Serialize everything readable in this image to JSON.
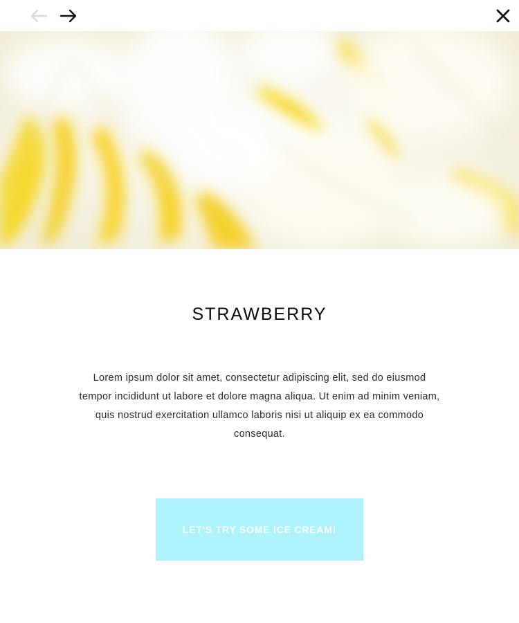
{
  "nav": {
    "prev_icon": "arrow-left-icon",
    "next_icon": "arrow-right-icon",
    "close_icon": "close-icon",
    "prev_color": "#d9d9d9",
    "next_color": "#111111"
  },
  "hero": {
    "image": "lemon-swirl-ice-cream-closeup"
  },
  "content": {
    "title": "STRAWBERRY",
    "description": "Lorem ipsum dolor sit amet, consectetur adipiscing elit, sed do eiusmod tempor incididunt ut labore et dolore magna aliqua. Ut enim ad minim veniam, quis nostrud exercitation ullamco laboris nisi ut aliquip ex ea commodo consequat."
  },
  "cta": {
    "label": "LET'S TRY SOME ICE CREAM!",
    "background": "#aef3fb",
    "text_color": "#ffffff"
  }
}
